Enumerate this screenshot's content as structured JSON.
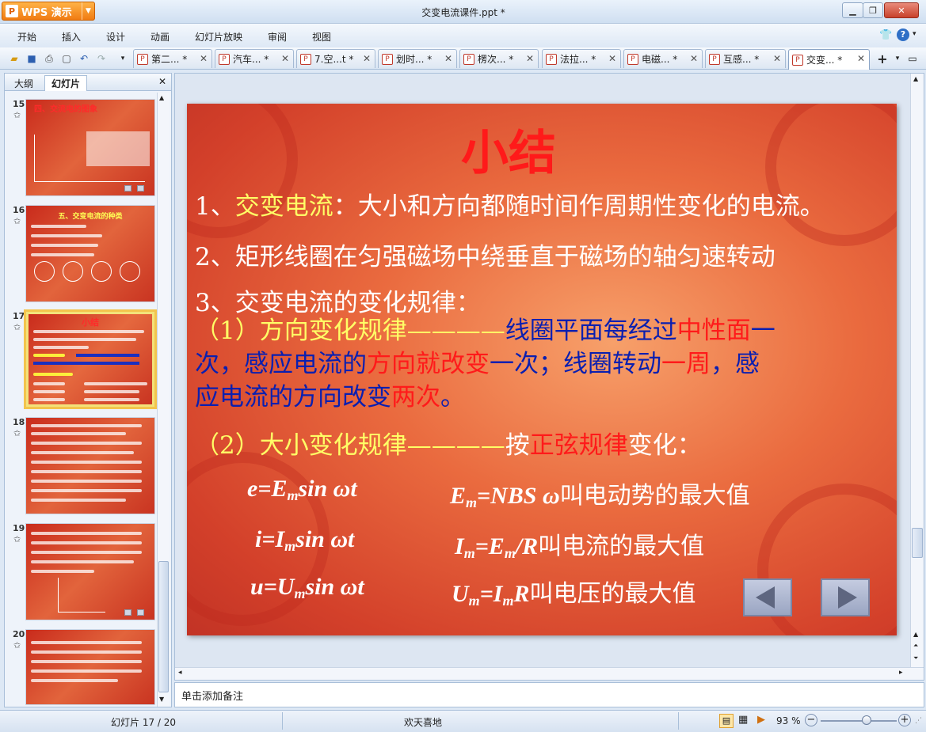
{
  "app": {
    "name": "WPS 演示",
    "logo": "P",
    "window_title": "交变电流课件.ppt *"
  },
  "menu": [
    "开始",
    "插入",
    "设计",
    "动画",
    "幻灯片放映",
    "审阅",
    "视图"
  ],
  "tabs": [
    {
      "label": "第二... *"
    },
    {
      "label": "汽车... *"
    },
    {
      "label": "7.空...t *"
    },
    {
      "label": "划时... *"
    },
    {
      "label": "楞次... *"
    },
    {
      "label": "法拉... *"
    },
    {
      "label": "电磁... *"
    },
    {
      "label": "互感... *"
    },
    {
      "label": "交变... *",
      "active": true
    }
  ],
  "panel_tabs": {
    "outline": "大纲",
    "slides": "幻灯片"
  },
  "thumbnails": [
    {
      "num": "15",
      "title": "四、交流电的图象"
    },
    {
      "num": "16",
      "title": "五、交变电流的种类"
    },
    {
      "num": "17",
      "title": "小结",
      "selected": true
    },
    {
      "num": "18",
      "title": ""
    },
    {
      "num": "19",
      "title": ""
    },
    {
      "num": "20",
      "title": ""
    }
  ],
  "slide": {
    "title": "小结",
    "p1": {
      "num": "1、",
      "hl": "交变电流",
      "rest": "：大小和方向都随时间作周期性变化的电流。"
    },
    "p2": "2、矩形线圈在匀强磁场中绕垂直于磁场的轴匀速转动",
    "p3": "3、交变电流的变化规律：",
    "s1": {
      "a": "（1）",
      "b": "方向变化规律",
      "c": "————",
      "d": "线圈平面每经过",
      "e": "中性面",
      "f": "一",
      "g": "次，感应电流的",
      "h": "方向就改变",
      "i": "一次；线圈转动",
      "j": "一周",
      "k": "，感",
      "l": "应电流的方向改变",
      "m": "两次",
      "n": "。"
    },
    "s2": {
      "a": "（2）",
      "b": "大小变化规律",
      "c": "————",
      "d": "按",
      "e": "正弦规律",
      "f": "变化："
    },
    "formulas": [
      {
        "lhs_var": "e",
        "lhs_sym": "E",
        "lhs_sub": "m",
        "lhs_tail": "sin ωt",
        "rhs_sym": "E",
        "rhs_sub": "m",
        "rhs_expr": "=NBS ω",
        "rhs_desc": "叫电动势的最大值"
      },
      {
        "lhs_var": "i",
        "lhs_sym": "I",
        "lhs_sub": "m",
        "lhs_tail": "sin ωt",
        "rhs_sym": "I",
        "rhs_sub": "m",
        "rhs_expr": "=E",
        "rhs_sub2": "m",
        "rhs_tail": "/R",
        "rhs_desc": "叫电流的最大值"
      },
      {
        "lhs_var": "u",
        "lhs_sym": "U",
        "lhs_sub": "m",
        "lhs_tail": "sin ωt",
        "rhs_sym": "U",
        "rhs_sub": "m",
        "rhs_expr": "=I",
        "rhs_sub2": "m",
        "rhs_tail": "R",
        "rhs_desc": "叫电压的最大值"
      }
    ]
  },
  "notes_placeholder": "单击添加备注",
  "status": {
    "slide_indicator": "幻灯片 17 / 20",
    "theme": "欢天喜地",
    "zoom": "93 %",
    "zoom_level": 0.6
  },
  "colors": {
    "accent": "#f07b12",
    "slide_red": "#d3402a",
    "text_blue": "#0a1fb0",
    "text_yellow": "#ffff66",
    "text_red": "#ff1a1a"
  }
}
